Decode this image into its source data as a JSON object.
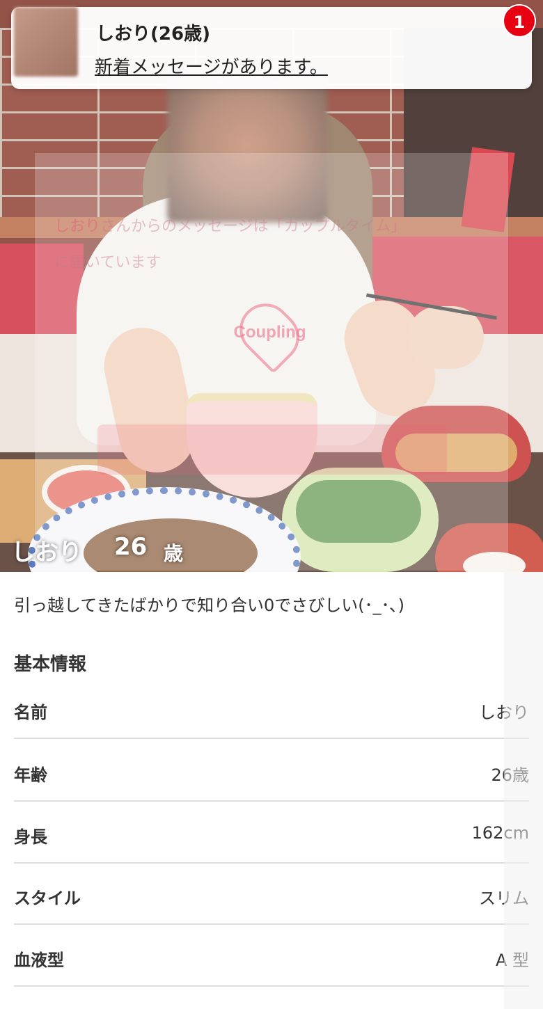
{
  "notification": {
    "title": "しおり(26歳)",
    "message": "新着メッセージがあります。",
    "badge_count": "1"
  },
  "hero": {
    "name": "しおり",
    "age": "26",
    "age_unit": "歳",
    "overlay_name": "しおり",
    "overlay_line1_rest": "さんからのメッセージは「カップルタイム」",
    "overlay_line2": "に届いています",
    "watermark": "Coupling"
  },
  "profile": {
    "bio": "引っ越してきたばかりで知り合い0でさびしい(･_･､)",
    "section_title": "基本情報",
    "rows": [
      {
        "label": "名前",
        "value": "しおり"
      },
      {
        "label": "年齢",
        "value": "26歳"
      },
      {
        "label": "身長",
        "value": "162cm"
      },
      {
        "label": "スタイル",
        "value": "スリム"
      },
      {
        "label": "血液型",
        "value": "A 型"
      }
    ]
  },
  "colors": {
    "badge": "#e60012",
    "accent_pink": "#ec6e87"
  }
}
